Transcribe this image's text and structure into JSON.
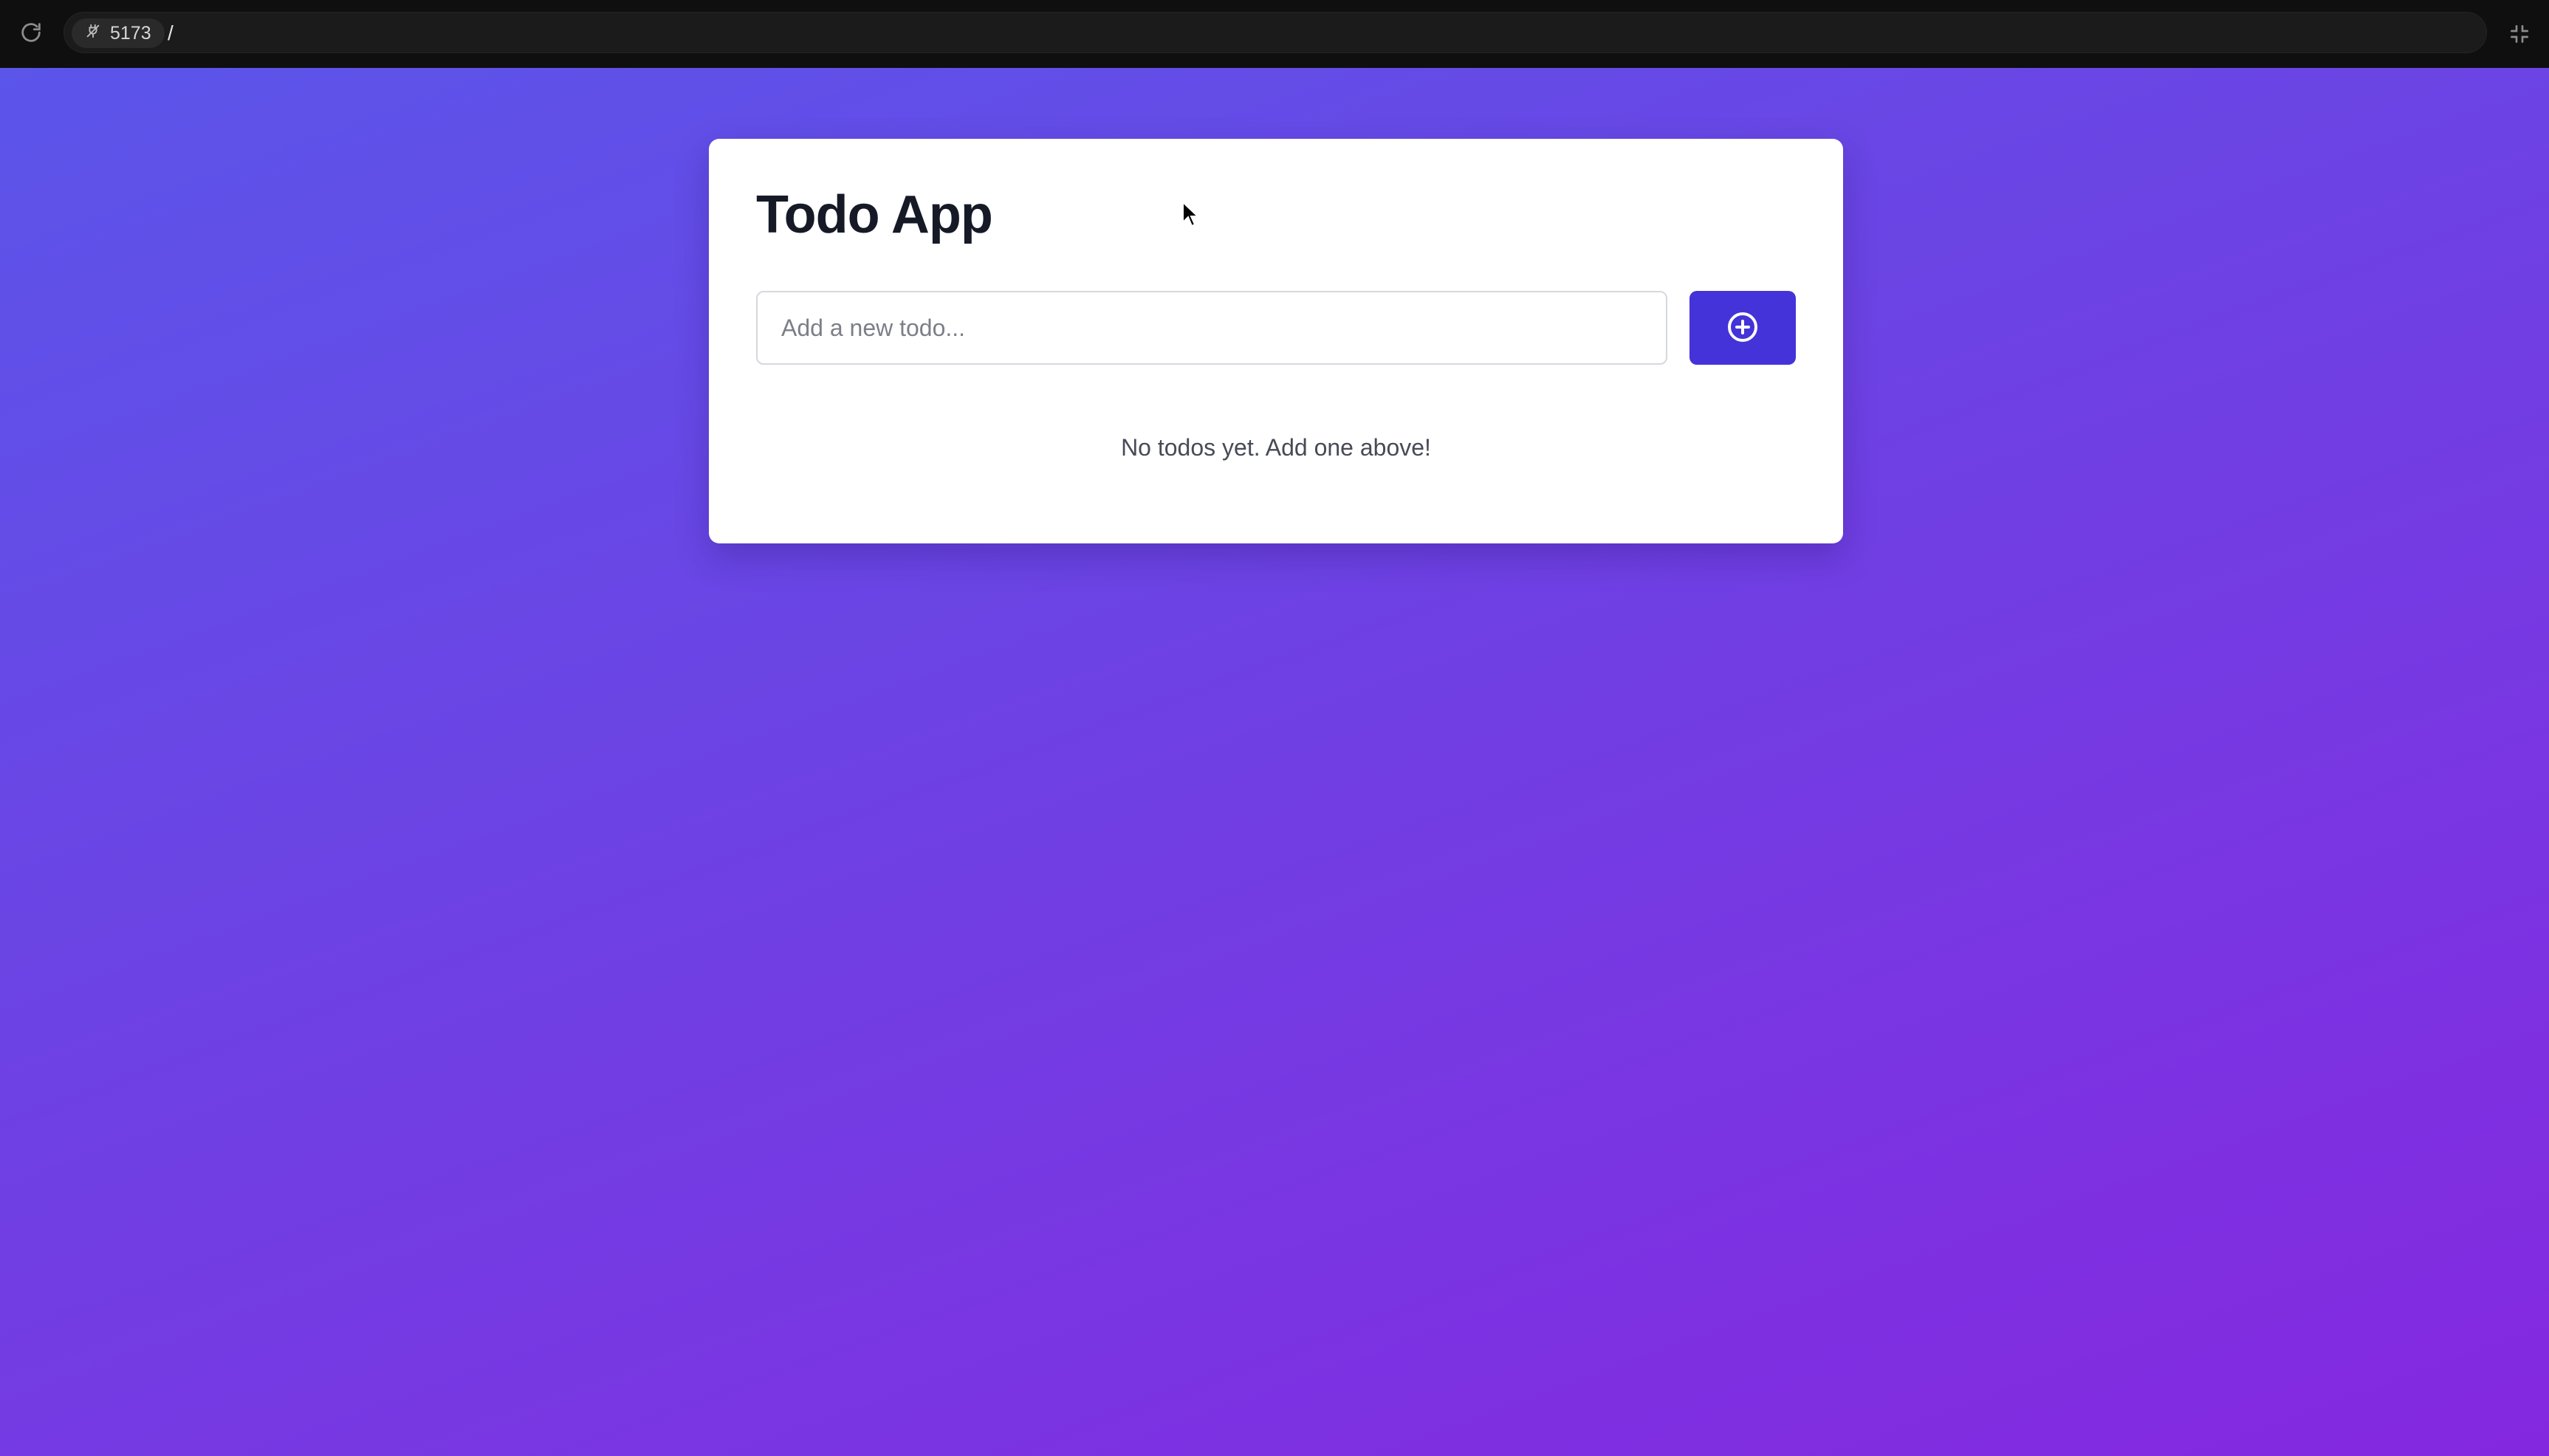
{
  "browser": {
    "port_label": "5173",
    "path_label": "/",
    "icons": {
      "reload": "reload-icon",
      "port_status": "disconnected-plug-icon",
      "exit_fullscreen": "exit-fullscreen-icon"
    }
  },
  "app": {
    "title": "Todo App",
    "input": {
      "placeholder": "Add a new todo...",
      "value": ""
    },
    "add_button": {
      "icon": "plus-circle-icon"
    },
    "empty_message": "No todos yet. Add one above!"
  },
  "colors": {
    "gradient_start": "#5b55ea",
    "gradient_end": "#8428df",
    "accent": "#4433d8",
    "title_text": "#151a26",
    "muted_text": "#474b55"
  }
}
